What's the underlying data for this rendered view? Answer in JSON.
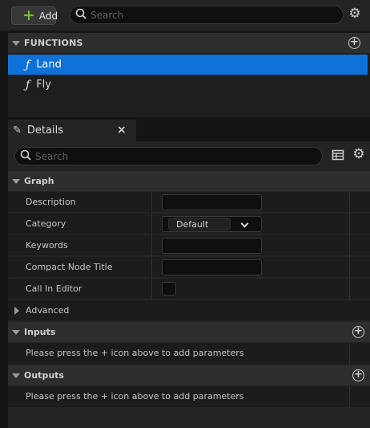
{
  "toolbar": {
    "add_label": "Add",
    "search_placeholder": "Search"
  },
  "functions": {
    "header": "FUNCTIONS",
    "items": [
      {
        "label": "Land",
        "selected": true
      },
      {
        "label": "Fly",
        "selected": false
      }
    ]
  },
  "details": {
    "tab_label": "Details",
    "search_placeholder": "Search",
    "graph": {
      "header": "Graph",
      "description_label": "Description",
      "description_value": "",
      "category_label": "Category",
      "category_value": "Default",
      "keywords_label": "Keywords",
      "keywords_value": "",
      "compact_node_title_label": "Compact Node Title",
      "compact_node_title_value": "",
      "call_in_editor_label": "Call In Editor",
      "call_in_editor_checked": false
    },
    "advanced": {
      "header": "Advanced"
    },
    "inputs": {
      "header": "Inputs",
      "hint": "Please press the + icon above to add parameters"
    },
    "outputs": {
      "header": "Outputs",
      "hint": "Please press the + icon above to add parameters"
    }
  },
  "colors": {
    "selection": "#0e71d8",
    "add_plus": "#6cbd2f",
    "panel_bg": "#242424",
    "row_bg": "#1c1c1c"
  },
  "icons": [
    "plus-icon",
    "search-icon",
    "gear-icon",
    "circle-plus-icon",
    "function-icon",
    "pencil-icon",
    "close-icon",
    "table-view-icon",
    "chevron-down-icon",
    "caret-down-icon",
    "caret-right-icon"
  ]
}
